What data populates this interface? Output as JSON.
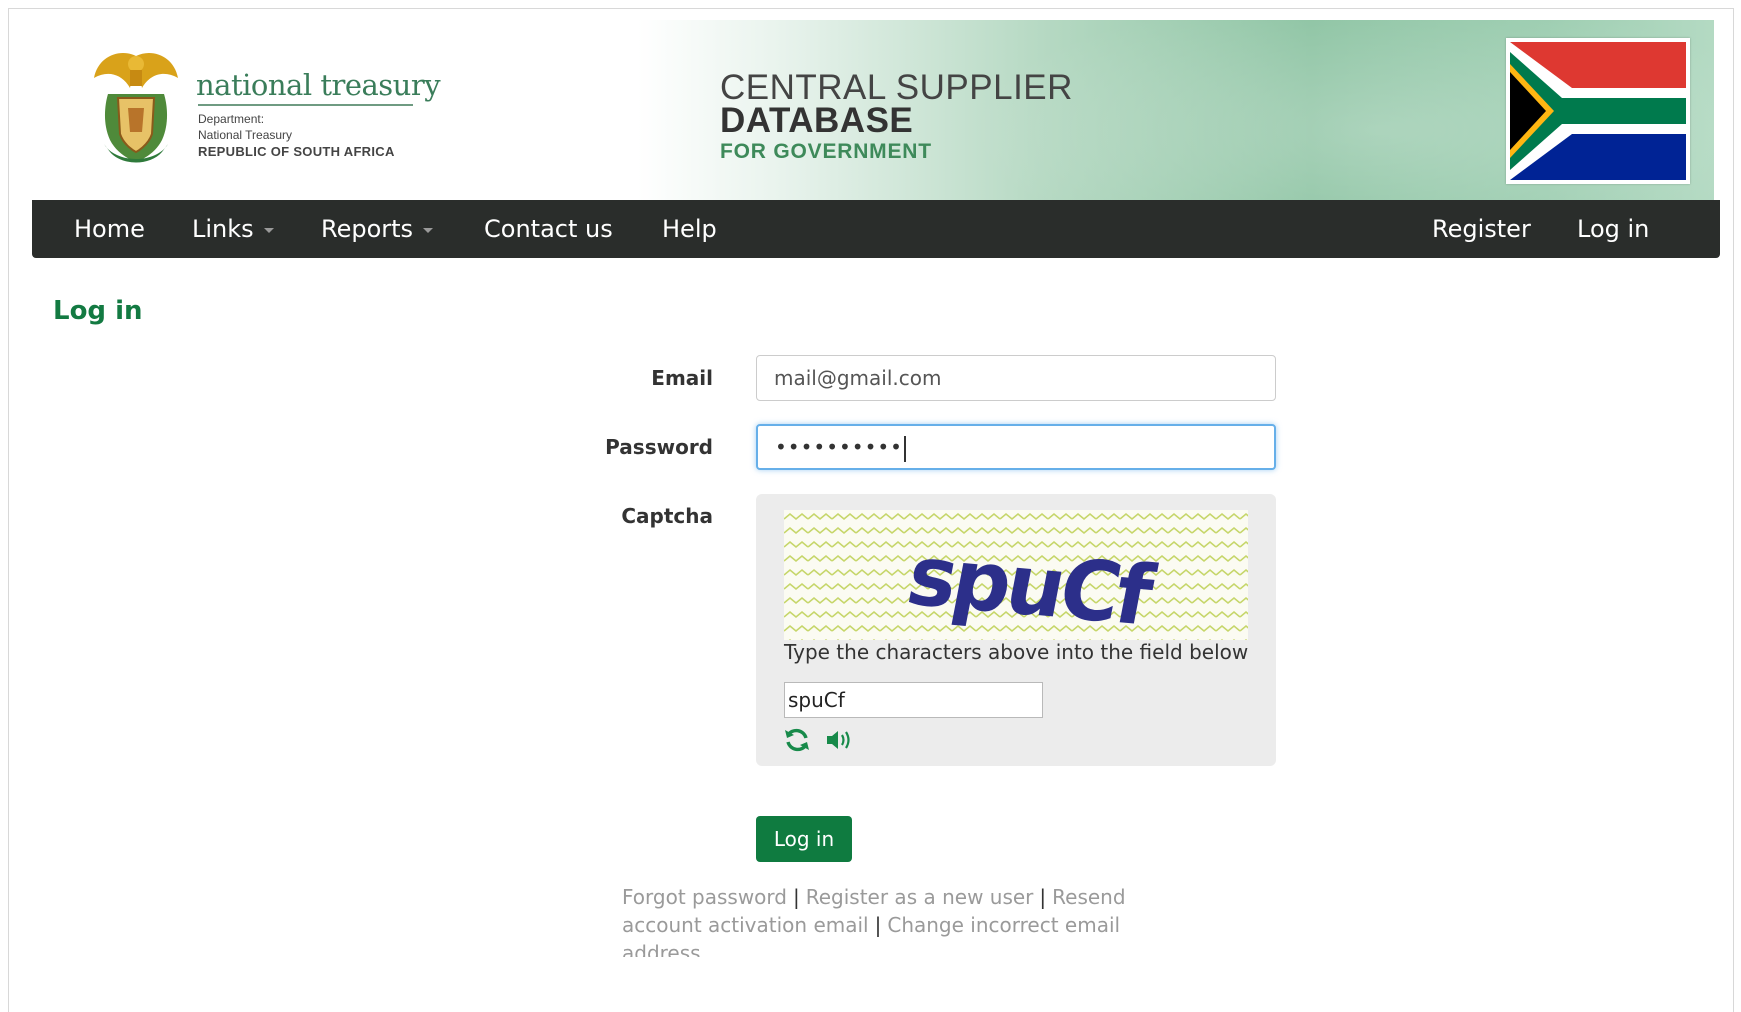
{
  "banner": {
    "department_name": "national treasury",
    "department_lines": [
      "Department:",
      "National Treasury",
      "REPUBLIC OF SOUTH AFRICA"
    ],
    "title_line1": "CENTRAL SUPPLIER",
    "title_line2": "DATABASE",
    "title_line3": "FOR GOVERNMENT"
  },
  "nav": {
    "left": [
      {
        "label": "Home",
        "has_dropdown": false
      },
      {
        "label": "Links",
        "has_dropdown": true
      },
      {
        "label": "Reports",
        "has_dropdown": true
      },
      {
        "label": "Contact us",
        "has_dropdown": false
      },
      {
        "label": "Help",
        "has_dropdown": false
      }
    ],
    "right": [
      {
        "label": "Register"
      },
      {
        "label": "Log in"
      }
    ]
  },
  "page": {
    "title": "Log in"
  },
  "form": {
    "email_label": "Email",
    "email_value": "mail@gmail.com",
    "password_label": "Password",
    "password_value": "••••••••••",
    "captcha_label": "Captcha",
    "captcha_image_text": "spuCf",
    "captcha_instruction": "Type the characters above into the field below",
    "captcha_value": "spuCf",
    "captcha_icons": [
      "refresh-icon",
      "audio-icon"
    ],
    "submit_label": "Log in"
  },
  "footer_links": [
    "Forgot password",
    "Register as a new user",
    "Resend account activation email",
    "Change incorrect email address"
  ],
  "colors": {
    "brand_green": "#0f7b40",
    "title_green": "#137a42",
    "navbar_bg": "#2a2d2b",
    "focus_blue": "#66afe9"
  }
}
